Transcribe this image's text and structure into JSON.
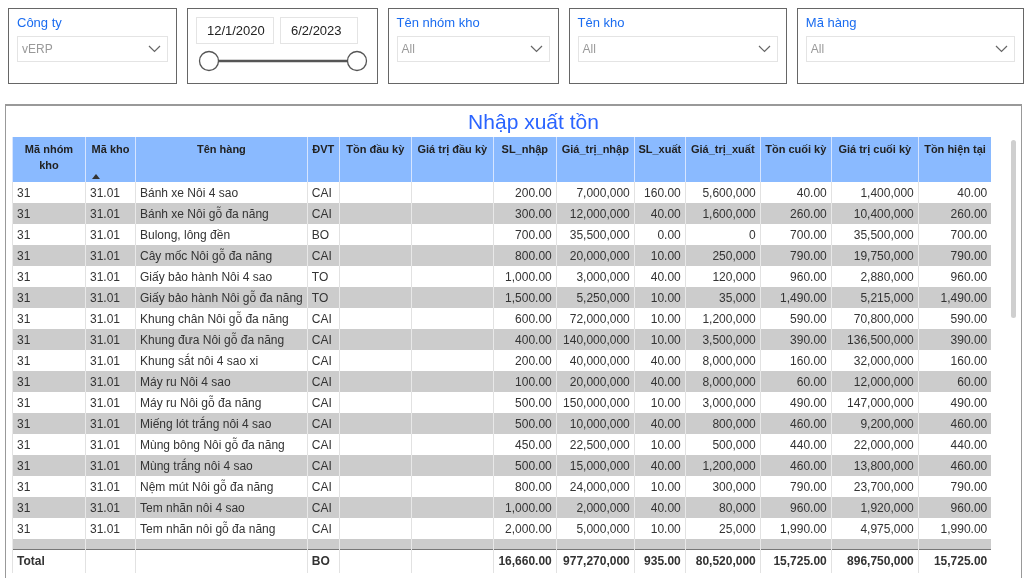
{
  "filters": [
    {
      "kind": "dropdown",
      "label": "Công ty",
      "value": "vERP"
    },
    {
      "kind": "daterange",
      "start": "12/1/2020",
      "end": "6/2/2023",
      "thumbs": [
        {
          "level": 0
        },
        {
          "level": 1
        }
      ]
    },
    {
      "kind": "dropdown",
      "label": "Tên nhóm kho",
      "value": "All"
    },
    {
      "kind": "dropdown",
      "label": "Tên kho",
      "value": "All"
    },
    {
      "kind": "dropdown",
      "label": "Mã hàng",
      "value": "All"
    }
  ],
  "table": {
    "title": "Nhập xuất tồn",
    "columns": [
      {
        "label": "Mã nhóm kho",
        "sorted": false
      },
      {
        "label": "Mã kho",
        "sorted": true
      },
      {
        "label": "Tên hàng",
        "sorted": false
      },
      {
        "label": "ĐVT",
        "sorted": false
      },
      {
        "label": "Tồn đầu kỳ",
        "sorted": false
      },
      {
        "label": "Giá trị đầu kỳ",
        "sorted": false
      },
      {
        "label": "SL_nhập",
        "sorted": false
      },
      {
        "label": "Giá_trị_nhập",
        "sorted": false
      },
      {
        "label": "SL_xuất",
        "sorted": false
      },
      {
        "label": "Giá_trị_xuất",
        "sorted": false
      },
      {
        "label": "Tồn cuối kỳ",
        "sorted": false
      },
      {
        "label": "Giá trị cuối kỳ",
        "sorted": false
      },
      {
        "label": "Tồn hiện tại",
        "sorted": false
      }
    ],
    "rows": [
      [
        "31",
        "31.01",
        "Bánh xe Nôi 4 sao",
        "CAI",
        null,
        null,
        "200.00",
        "7,000,000",
        "160.00",
        "5,600,000",
        "40.00",
        "1,400,000",
        "40.00"
      ],
      [
        "31",
        "31.01",
        "Bánh xe Nôi gỗ đa năng",
        "CAI",
        null,
        null,
        "300.00",
        "12,000,000",
        "40.00",
        "1,600,000",
        "260.00",
        "10,400,000",
        "260.00"
      ],
      [
        "31",
        "31.01",
        "Bulong, lông đền",
        "BO",
        null,
        null,
        "700.00",
        "35,500,000",
        "0.00",
        "0",
        "700.00",
        "35,500,000",
        "700.00"
      ],
      [
        "31",
        "31.01",
        "Cây mốc Nôi gỗ đa năng",
        "CAI",
        null,
        null,
        "800.00",
        "20,000,000",
        "10.00",
        "250,000",
        "790.00",
        "19,750,000",
        "790.00"
      ],
      [
        "31",
        "31.01",
        "Giấy bảo hành Nôi 4 sao",
        "TO",
        null,
        null,
        "1,000.00",
        "3,000,000",
        "40.00",
        "120,000",
        "960.00",
        "2,880,000",
        "960.00"
      ],
      [
        "31",
        "31.01",
        "Giấy bảo hành Nôi gỗ đa năng",
        "TO",
        null,
        null,
        "1,500.00",
        "5,250,000",
        "10.00",
        "35,000",
        "1,490.00",
        "5,215,000",
        "1,490.00"
      ],
      [
        "31",
        "31.01",
        "Khung chân Nôi gỗ đa năng",
        "CAI",
        null,
        null,
        "600.00",
        "72,000,000",
        "10.00",
        "1,200,000",
        "590.00",
        "70,800,000",
        "590.00"
      ],
      [
        "31",
        "31.01",
        "Khung đưa Nôi gỗ đa năng",
        "CAI",
        null,
        null,
        "400.00",
        "140,000,000",
        "10.00",
        "3,500,000",
        "390.00",
        "136,500,000",
        "390.00"
      ],
      [
        "31",
        "31.01",
        "Khung sắt nôi 4 sao xi",
        "CAI",
        null,
        null,
        "200.00",
        "40,000,000",
        "40.00",
        "8,000,000",
        "160.00",
        "32,000,000",
        "160.00"
      ],
      [
        "31",
        "31.01",
        "Máy ru Nôi 4 sao",
        "CAI",
        null,
        null,
        "100.00",
        "20,000,000",
        "40.00",
        "8,000,000",
        "60.00",
        "12,000,000",
        "60.00"
      ],
      [
        "31",
        "31.01",
        "Máy ru Nôi gỗ đa năng",
        "CAI",
        null,
        null,
        "500.00",
        "150,000,000",
        "10.00",
        "3,000,000",
        "490.00",
        "147,000,000",
        "490.00"
      ],
      [
        "31",
        "31.01",
        "Miếng lót trắng nôi 4 sao",
        "CAI",
        null,
        null,
        "500.00",
        "10,000,000",
        "40.00",
        "800,000",
        "460.00",
        "9,200,000",
        "460.00"
      ],
      [
        "31",
        "31.01",
        "Mùng bông Nôi gỗ đa năng",
        "CAI",
        null,
        null,
        "450.00",
        "22,500,000",
        "10.00",
        "500,000",
        "440.00",
        "22,000,000",
        "440.00"
      ],
      [
        "31",
        "31.01",
        "Mùng trắng nôi 4 sao",
        "CAI",
        null,
        null,
        "500.00",
        "15,000,000",
        "40.00",
        "1,200,000",
        "460.00",
        "13,800,000",
        "460.00"
      ],
      [
        "31",
        "31.01",
        "Nệm mút Nôi gỗ đa năng",
        "CAI",
        null,
        null,
        "800.00",
        "24,000,000",
        "10.00",
        "300,000",
        "790.00",
        "23,700,000",
        "790.00"
      ],
      [
        "31",
        "31.01",
        "Tem nhãn nôi 4 sao",
        "CAI",
        null,
        null,
        "1,000.00",
        "2,000,000",
        "40.00",
        "80,000",
        "960.00",
        "1,920,000",
        "960.00"
      ],
      [
        "31",
        "31.01",
        "Tem nhãn nôi gỗ đa năng",
        "CAI",
        null,
        null,
        "2,000.00",
        "5,000,000",
        "10.00",
        "25,000",
        "1,990.00",
        "4,975,000",
        "1,990.00"
      ]
    ],
    "total": {
      "label": "Total",
      "unit": "BO",
      "sums": [
        "16,660.00",
        "977,270,000",
        "935.00",
        "80,520,000",
        "15,725.00",
        "896,750,000",
        "15,725.00"
      ]
    }
  }
}
